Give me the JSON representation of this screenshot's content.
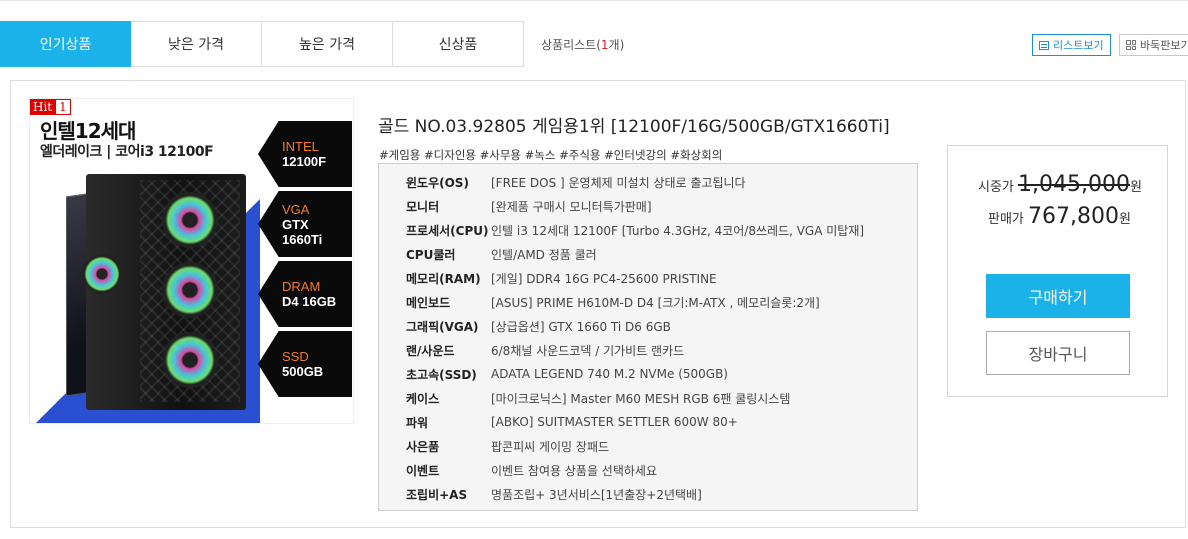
{
  "tabs": [
    {
      "label": "인기상품",
      "active": true
    },
    {
      "label": "낮은 가격",
      "active": false
    },
    {
      "label": "높은 가격",
      "active": false
    },
    {
      "label": "신상품",
      "active": false
    }
  ],
  "list_count": {
    "prefix": "상품리스트(",
    "count": "1",
    "suffix": "개)"
  },
  "view_buttons": {
    "list": "리스트보기",
    "grid": "바둑판보기"
  },
  "product": {
    "hit_label": "Hit",
    "hit_count": "1",
    "thumb_headline": "인텔12세대",
    "thumb_subline": "엘더레이크 | 코어i3 12100F",
    "badges": [
      {
        "k": "INTEL",
        "v": "12100F"
      },
      {
        "k": "VGA",
        "v": "GTX 1660Ti"
      },
      {
        "k": "DRAM",
        "v": "D4 16GB"
      },
      {
        "k": "SSD",
        "v": "500GB"
      }
    ],
    "title": "골드 NO.03.92805 게임용1위 [12100F/16G/500GB/GTX1660Ti]",
    "tags": "#게임용 #디자인용 #사무용 #녹스 #주식용 #인터넷강의 #화상회의",
    "specs": [
      {
        "label": "윈도우(OS)",
        "value": "[FREE DOS ] 운영체제 미설치 상태로 출고됩니다"
      },
      {
        "label": "모니터",
        "value": "[완제품 구매시 모니터특가판매]"
      },
      {
        "label": "프로세서(CPU)",
        "value": "인텔 i3 12세대 12100F [Turbo 4.3GHz, 4코어/8쓰레드, VGA 미탑재]"
      },
      {
        "label": "CPU쿨러",
        "value": "인텔/AMD 정품 쿨러"
      },
      {
        "label": "메모리(RAM)",
        "value": "[게일] DDR4 16G PC4-25600 PRISTINE"
      },
      {
        "label": "메인보드",
        "value": "[ASUS] PRIME H610M-D D4 [크기:M-ATX , 메모리슬롯:2개]"
      },
      {
        "label": "그래픽(VGA)",
        "value": "[상급옵션] GTX 1660 Ti D6 6GB"
      },
      {
        "label": "랜/사운드",
        "value": "6/8채널 사운드코덱 / 기가비트 랜카드"
      },
      {
        "label": "초고속(SSD)",
        "value": "ADATA LEGEND 740 M.2 NVMe (500GB)"
      },
      {
        "label": "케이스",
        "value": "[마이크로닉스] Master M60 MESH RGB 6팬 쿨링시스템"
      },
      {
        "label": "파워",
        "value": "[ABKO] SUITMASTER SETTLER 600W 80+"
      },
      {
        "label": "사은품",
        "value": "팝콘피씨 게이밍 장패드"
      },
      {
        "label": "이벤트",
        "value": "이벤트 참여용 상품을 선택하세요"
      },
      {
        "label": "조립비+AS",
        "value": "명품조립+ 3년서비스[1년출장+2년택배]"
      }
    ],
    "price": {
      "market_label": "시중가",
      "market_price": "1,045,000",
      "sale_label": "판매가",
      "sale_price": "767,800",
      "unit": "원"
    },
    "buy_label": "구매하기",
    "cart_label": "장바구니"
  },
  "colors": {
    "accent": "#1ab2e8",
    "count_red": "#e02020"
  }
}
